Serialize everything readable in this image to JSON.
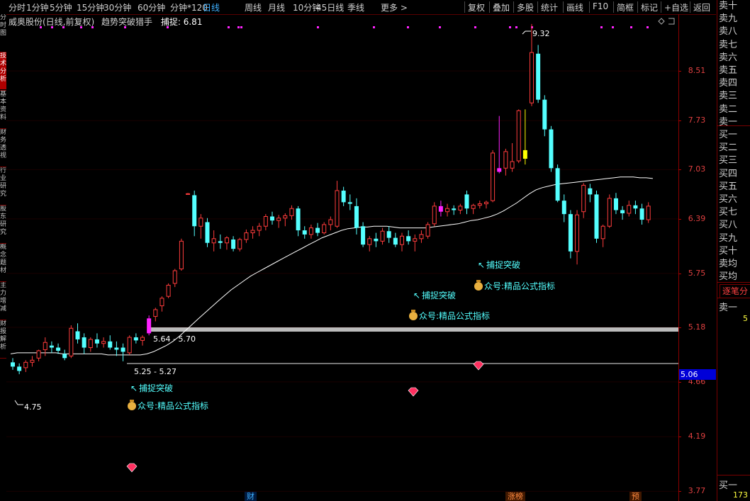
{
  "toolbar": {
    "periods": [
      "分时",
      "1分钟",
      "5分钟",
      "15分钟",
      "30分钟",
      "60分钟",
      "分钟*120",
      "日线",
      "周线",
      "月线",
      "10分钟",
      "45日线",
      "季线",
      "更多 >"
    ],
    "active_period": "日线",
    "actions": [
      "复权",
      "叠加",
      "多股",
      "统计",
      "画线",
      "F10",
      "简框",
      "标记",
      "+自选",
      "返回"
    ]
  },
  "left_tabs": [
    "分时图",
    "技术分析",
    "基本资料",
    "财务透视",
    "行业研究",
    "股东研究",
    "概念题材",
    "主力增减",
    "财报解析"
  ],
  "info": {
    "ticker": "威奥股份(日线,前复权)",
    "indicator": "趋势突破猎手",
    "capture_label": "捕捉:",
    "capture_value": "6.81"
  },
  "axis": {
    "labels": [
      "8.51",
      "7.73",
      "7.03",
      "6.39",
      "5.75",
      "5.18",
      "4.66",
      "4.19",
      "3.77"
    ],
    "current_price": "5.06"
  },
  "annotations": {
    "high": "9.32",
    "low": "4.75",
    "zone_upper": "5.64 - 5.70",
    "zone_lower": "5.25 - 5.27",
    "breakout": "捕捉突破",
    "watermark": "众号:精品公式指标"
  },
  "bottom_tags": [
    "财",
    "涨榜",
    "预"
  ],
  "right_panel": {
    "sell_rows": [
      "卖十",
      "卖九",
      "卖八",
      "卖七",
      "卖六",
      "卖五",
      "卖四",
      "卖三",
      "卖二",
      "卖一"
    ],
    "buy_rows": [
      "买一",
      "买二",
      "买三",
      "买四",
      "买五",
      "买六",
      "买七",
      "买八",
      "买九",
      "买十"
    ],
    "avg_rows": [
      "卖均",
      "买均"
    ],
    "tab": "逐笔分",
    "sell1_label": "卖一",
    "sell1_vol": "5",
    "buy1_label": "买一",
    "buy1_vol": "173"
  },
  "colors": {
    "up": "#ff3c3c",
    "down": "#54ffff",
    "signal": "#ff22ff",
    "yellow_bar": "#ffff00",
    "ma_line": "#ffffff",
    "zone_bar": "#bbbbbb",
    "axis_text": "#e04040"
  },
  "chart_data": {
    "type": "candlestick",
    "ylim": [
      3.7,
      9.5
    ],
    "candles": [
      {
        "o": 4.84,
        "h": 4.88,
        "l": 4.77,
        "c": 4.8
      },
      {
        "o": 4.8,
        "h": 4.83,
        "l": 4.73,
        "c": 4.76
      },
      {
        "o": 4.79,
        "h": 4.86,
        "l": 4.75,
        "c": 4.84
      },
      {
        "o": 4.84,
        "h": 4.9,
        "l": 4.8,
        "c": 4.86
      },
      {
        "o": 4.88,
        "h": 4.96,
        "l": 4.85,
        "c": 4.95
      },
      {
        "o": 4.96,
        "h": 5.08,
        "l": 4.9,
        "c": 5.03
      },
      {
        "o": 5.0,
        "h": 5.04,
        "l": 4.93,
        "c": 4.98
      },
      {
        "o": 4.98,
        "h": 5.02,
        "l": 4.92,
        "c": 4.95
      },
      {
        "o": 4.92,
        "h": 4.96,
        "l": 4.86,
        "c": 4.88
      },
      {
        "o": 4.9,
        "h": 5.2,
        "l": 4.88,
        "c": 5.17
      },
      {
        "o": 5.14,
        "h": 5.22,
        "l": 5.02,
        "c": 5.06
      },
      {
        "o": 5.08,
        "h": 5.12,
        "l": 4.92,
        "c": 4.98
      },
      {
        "o": 4.98,
        "h": 5.08,
        "l": 4.94,
        "c": 5.06
      },
      {
        "o": 5.06,
        "h": 5.12,
        "l": 4.98,
        "c": 5.02
      },
      {
        "o": 5.02,
        "h": 5.08,
        "l": 4.98,
        "c": 5.04
      },
      {
        "o": 5.04,
        "h": 5.1,
        "l": 4.96,
        "c": 4.98
      },
      {
        "o": 4.98,
        "h": 5.04,
        "l": 4.9,
        "c": 4.96
      },
      {
        "o": 4.98,
        "h": 5.02,
        "l": 4.85,
        "c": 4.94
      },
      {
        "o": 4.93,
        "h": 5.1,
        "l": 4.91,
        "c": 5.08
      },
      {
        "o": 5.08,
        "h": 5.12,
        "l": 5.02,
        "c": 5.05
      },
      {
        "o": 5.05,
        "h": 5.1,
        "l": 5.0,
        "c": 5.08
      },
      {
        "o": 5.12,
        "h": 5.3,
        "l": 5.1,
        "c": 5.27
      },
      {
        "o": 5.29,
        "h": 5.38,
        "l": 5.24,
        "c": 5.36
      },
      {
        "o": 5.4,
        "h": 5.5,
        "l": 5.34,
        "c": 5.48
      },
      {
        "o": 5.5,
        "h": 5.64,
        "l": 5.48,
        "c": 5.62
      },
      {
        "o": 5.64,
        "h": 5.8,
        "l": 5.6,
        "c": 5.78
      },
      {
        "o": 5.8,
        "h": 6.15,
        "l": 5.78,
        "c": 6.12
      },
      {
        "o": 6.7,
        "h": 6.72,
        "l": 6.7,
        "c": 6.71
      },
      {
        "o": 6.69,
        "h": 6.75,
        "l": 6.18,
        "c": 6.3
      },
      {
        "o": 6.3,
        "h": 6.45,
        "l": 6.15,
        "c": 6.4
      },
      {
        "o": 6.35,
        "h": 6.4,
        "l": 6.05,
        "c": 6.1
      },
      {
        "o": 6.1,
        "h": 6.25,
        "l": 6.0,
        "c": 6.15
      },
      {
        "o": 6.12,
        "h": 6.2,
        "l": 6.03,
        "c": 6.1
      },
      {
        "o": 6.1,
        "h": 6.18,
        "l": 6.02,
        "c": 6.16
      },
      {
        "o": 6.14,
        "h": 6.18,
        "l": 6.0,
        "c": 6.03
      },
      {
        "o": 6.03,
        "h": 6.16,
        "l": 6.0,
        "c": 6.14
      },
      {
        "o": 6.14,
        "h": 6.26,
        "l": 6.1,
        "c": 6.22
      },
      {
        "o": 6.22,
        "h": 6.3,
        "l": 6.15,
        "c": 6.25
      },
      {
        "o": 6.25,
        "h": 6.34,
        "l": 6.18,
        "c": 6.3
      },
      {
        "o": 6.3,
        "h": 6.45,
        "l": 6.25,
        "c": 6.42
      },
      {
        "o": 6.42,
        "h": 6.48,
        "l": 6.32,
        "c": 6.37
      },
      {
        "o": 6.37,
        "h": 6.44,
        "l": 6.28,
        "c": 6.4
      },
      {
        "o": 6.4,
        "h": 6.46,
        "l": 6.3,
        "c": 6.43
      },
      {
        "o": 6.43,
        "h": 6.56,
        "l": 6.38,
        "c": 6.52
      },
      {
        "o": 6.52,
        "h": 6.55,
        "l": 6.18,
        "c": 6.25
      },
      {
        "o": 6.25,
        "h": 6.3,
        "l": 6.15,
        "c": 6.2
      },
      {
        "o": 6.2,
        "h": 6.32,
        "l": 6.15,
        "c": 6.28
      },
      {
        "o": 6.28,
        "h": 6.34,
        "l": 6.18,
        "c": 6.22
      },
      {
        "o": 6.22,
        "h": 6.35,
        "l": 6.2,
        "c": 6.32
      },
      {
        "o": 6.32,
        "h": 6.42,
        "l": 6.25,
        "c": 6.38
      },
      {
        "o": 6.3,
        "h": 6.88,
        "l": 6.28,
        "c": 6.75
      },
      {
        "o": 6.75,
        "h": 6.8,
        "l": 6.55,
        "c": 6.6
      },
      {
        "o": 6.6,
        "h": 6.7,
        "l": 6.5,
        "c": 6.58
      },
      {
        "o": 6.55,
        "h": 6.65,
        "l": 6.2,
        "c": 6.28
      },
      {
        "o": 6.3,
        "h": 6.35,
        "l": 6.05,
        "c": 6.08
      },
      {
        "o": 6.08,
        "h": 6.18,
        "l": 6.0,
        "c": 6.15
      },
      {
        "o": 6.15,
        "h": 6.22,
        "l": 6.05,
        "c": 6.12
      },
      {
        "o": 6.12,
        "h": 6.28,
        "l": 6.08,
        "c": 6.24
      },
      {
        "o": 6.24,
        "h": 6.3,
        "l": 6.1,
        "c": 6.16
      },
      {
        "o": 6.16,
        "h": 6.22,
        "l": 6.05,
        "c": 6.08
      },
      {
        "o": 6.08,
        "h": 6.22,
        "l": 6.0,
        "c": 6.18
      },
      {
        "o": 6.18,
        "h": 6.25,
        "l": 6.08,
        "c": 6.12
      },
      {
        "o": 6.12,
        "h": 6.2,
        "l": 6.0,
        "c": 6.15
      },
      {
        "o": 6.15,
        "h": 6.25,
        "l": 6.1,
        "c": 6.2
      },
      {
        "o": 6.18,
        "h": 6.35,
        "l": 6.15,
        "c": 6.32
      },
      {
        "o": 6.33,
        "h": 6.6,
        "l": 6.3,
        "c": 6.55
      },
      {
        "o": 6.55,
        "h": 6.62,
        "l": 6.42,
        "c": 6.48
      },
      {
        "o": 6.48,
        "h": 6.58,
        "l": 6.42,
        "c": 6.52
      },
      {
        "o": 6.52,
        "h": 6.56,
        "l": 6.44,
        "c": 6.5
      },
      {
        "o": 6.5,
        "h": 6.58,
        "l": 6.45,
        "c": 6.55
      },
      {
        "o": 6.7,
        "h": 6.75,
        "l": 6.45,
        "c": 6.52
      },
      {
        "o": 6.52,
        "h": 6.58,
        "l": 6.45,
        "c": 6.56
      },
      {
        "o": 6.56,
        "h": 6.62,
        "l": 6.52,
        "c": 6.58
      },
      {
        "o": 6.58,
        "h": 6.62,
        "l": 6.52,
        "c": 6.6
      },
      {
        "o": 6.62,
        "h": 7.3,
        "l": 6.6,
        "c": 7.26
      },
      {
        "o": 7.0,
        "h": 7.8,
        "l": 6.98,
        "c": 7.05
      },
      {
        "o": 7.05,
        "h": 7.32,
        "l": 6.95,
        "c": 7.28
      },
      {
        "o": 7.05,
        "h": 7.4,
        "l": 7.0,
        "c": 7.14
      },
      {
        "o": 7.15,
        "h": 7.9,
        "l": 7.12,
        "c": 7.88
      },
      {
        "o": 7.3,
        "h": 7.9,
        "l": 7.1,
        "c": 7.18
      },
      {
        "o": 8.0,
        "h": 9.32,
        "l": 7.95,
        "c": 8.82
      },
      {
        "o": 8.8,
        "h": 8.95,
        "l": 8.0,
        "c": 8.05
      },
      {
        "o": 8.05,
        "h": 8.12,
        "l": 7.5,
        "c": 7.6
      },
      {
        "o": 7.6,
        "h": 7.65,
        "l": 7.0,
        "c": 7.05
      },
      {
        "o": 7.05,
        "h": 7.1,
        "l": 6.6,
        "c": 6.62
      },
      {
        "o": 6.62,
        "h": 6.7,
        "l": 6.35,
        "c": 6.45
      },
      {
        "o": 6.45,
        "h": 6.5,
        "l": 5.92,
        "c": 6.0
      },
      {
        "o": 6.0,
        "h": 6.5,
        "l": 5.85,
        "c": 6.44
      },
      {
        "o": 6.48,
        "h": 6.85,
        "l": 6.4,
        "c": 6.82
      },
      {
        "o": 6.78,
        "h": 6.84,
        "l": 6.6,
        "c": 6.7
      },
      {
        "o": 6.7,
        "h": 6.75,
        "l": 6.1,
        "c": 6.15
      },
      {
        "o": 6.15,
        "h": 6.32,
        "l": 6.05,
        "c": 6.3
      },
      {
        "o": 6.3,
        "h": 6.7,
        "l": 6.28,
        "c": 6.65
      },
      {
        "o": 6.65,
        "h": 6.72,
        "l": 6.45,
        "c": 6.5
      },
      {
        "o": 6.5,
        "h": 6.55,
        "l": 6.38,
        "c": 6.46
      },
      {
        "o": 6.46,
        "h": 6.62,
        "l": 6.42,
        "c": 6.56
      },
      {
        "o": 6.56,
        "h": 6.62,
        "l": 6.45,
        "c": 6.52
      },
      {
        "o": 6.52,
        "h": 6.58,
        "l": 6.32,
        "c": 6.38
      },
      {
        "o": 6.38,
        "h": 6.6,
        "l": 6.34,
        "c": 6.55
      }
    ],
    "yellow_index": 79,
    "signal_indices": [
      21,
      66,
      75
    ],
    "ma": [
      4.92,
      4.93,
      4.93,
      4.93,
      4.93,
      4.93,
      4.93,
      4.93,
      4.92,
      4.92,
      4.92,
      4.92,
      4.92,
      4.92,
      4.92,
      4.91,
      4.91,
      4.91,
      4.91,
      4.91,
      4.91,
      4.92,
      4.94,
      4.97,
      5.0,
      5.04,
      5.09,
      5.15,
      5.21,
      5.27,
      5.33,
      5.39,
      5.45,
      5.51,
      5.57,
      5.62,
      5.67,
      5.72,
      5.76,
      5.8,
      5.84,
      5.88,
      5.92,
      5.96,
      6.0,
      6.04,
      6.08,
      6.12,
      6.16,
      6.19,
      6.22,
      6.25,
      6.27,
      6.28,
      6.29,
      6.29,
      6.3,
      6.3,
      6.3,
      6.29,
      6.28,
      6.28,
      6.28,
      6.28,
      6.28,
      6.29,
      6.3,
      6.31,
      6.32,
      6.33,
      6.35,
      6.37,
      6.38,
      6.4,
      6.42,
      6.45,
      6.49,
      6.54,
      6.59,
      6.65,
      6.71,
      6.76,
      6.79,
      6.81,
      6.83,
      6.84,
      6.85,
      6.86,
      6.87,
      6.88,
      6.89,
      6.9,
      6.91,
      6.92,
      6.93,
      6.93,
      6.93,
      6.92,
      6.92,
      6.91
    ]
  }
}
